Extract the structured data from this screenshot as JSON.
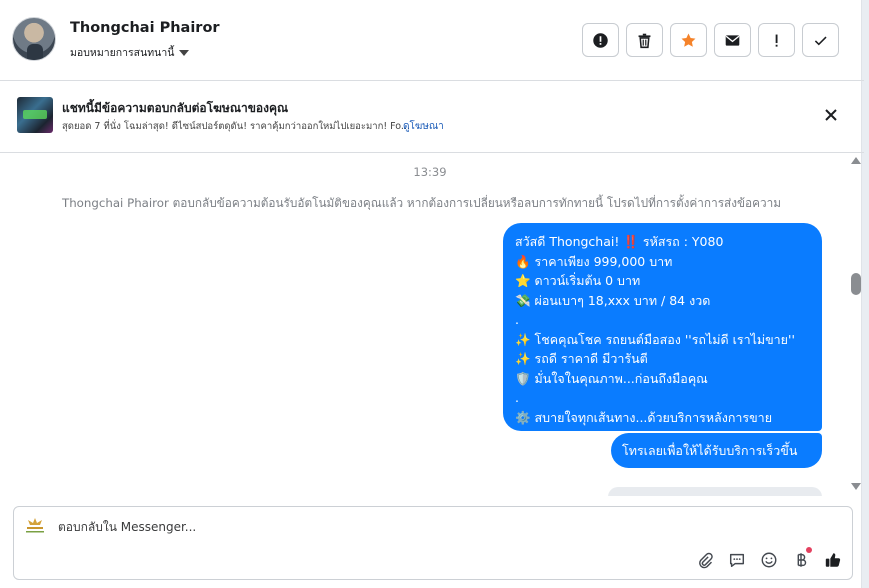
{
  "header": {
    "contact_name": "Thongchai Phairor",
    "assign_label": "มอบหมายการสนทนานี้",
    "actions": [
      {
        "name": "report-icon",
        "color": "#1c1e21"
      },
      {
        "name": "trash-icon",
        "color": "#1c1e21"
      },
      {
        "name": "star-icon",
        "color": "#f5832a"
      },
      {
        "name": "envelope-icon",
        "color": "#1c1e21"
      },
      {
        "name": "exclamation-icon",
        "color": "#1c1e21"
      },
      {
        "name": "check-icon",
        "color": "#1c1e21"
      }
    ]
  },
  "ad": {
    "title": "แชทนี้มีข้อความตอบกลับต่อโฆษณาของคุณ",
    "description": "สุดยอด 7 ที่นั่ง โฉมล่าสุด! ดีไซน์สปอร์ตดุดัน! ราคาคุ้มกว่าออกใหม่ไปเยอะมาก! Fo...",
    "link": "ดูโฆษณา"
  },
  "thread": {
    "time": "13:39",
    "notice": "Thongchai Phairor ตอบกลับข้อความต้อนรับอัตโนมัติของคุณแล้ว หากต้องการเปลี่ยนหรือลบการทักทายนี้ โปรดไปที่การตั้งค่าการส่งข้อความ",
    "message_lines": [
      "สวัสดี Thongchai! ‼️ รหัสรถ : Y080",
      "🔥 ราคาเพียง 999,000 บาท",
      "⭐ ดาวน์เริ่มต้น 0 บาท",
      "💸 ผ่อนเบาๆ 18,xxx บาท / 84 งวด",
      ".",
      "✨ โชคคุณโชค รถยนต์มือสอง ''รถไม่ดี เราไม่ขาย''",
      "✨ รถดี ราคาดี มีวารันตี",
      "🛡️ มั่นใจในคุณภาพ...ก่อนถึงมือคุณ",
      ".",
      "⚙️ สบายใจทุกเส้นทาง...ด้วยบริการหลังการขาย"
    ],
    "message_2": "โทรเลยเพื่อให้ได้รับบริการเร็วขึ้น",
    "bubble_color": "#0a7cff"
  },
  "composer": {
    "placeholder": "ตอบกลับใน Messenger...",
    "tools": [
      "paperclip-icon",
      "chat-bubble-icon",
      "smiley-icon",
      "baht-icon",
      "thumbs-up-icon"
    ]
  }
}
